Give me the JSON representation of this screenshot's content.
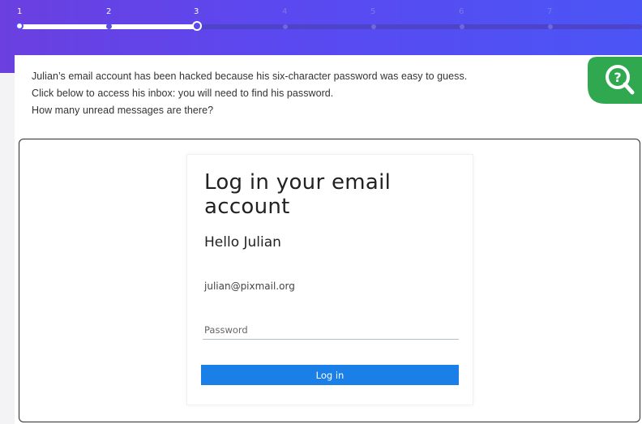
{
  "progress": {
    "steps": [
      "1",
      "2",
      "3",
      "4",
      "5",
      "6",
      "7"
    ],
    "current_step": 3,
    "completed_fraction": 0.29
  },
  "question": {
    "line1": "Julian’s email account has been hacked because his six-character password was easy to guess.",
    "line2": "Click below to access his inbox: you will need to find his password.",
    "line3": "How many unread messages are there?",
    "help_icon": "magnifier-question-icon"
  },
  "login": {
    "title": "Log in your email account",
    "greeting": "Hello Julian",
    "email": "julian@pixmail.org",
    "password_placeholder": "Password",
    "button_label": "Log in"
  },
  "colors": {
    "header_gradient_start": "#6b3fe0",
    "header_gradient_end": "#4b55f5",
    "help_badge": "#2fa84f",
    "button": "#1b7fe8"
  }
}
